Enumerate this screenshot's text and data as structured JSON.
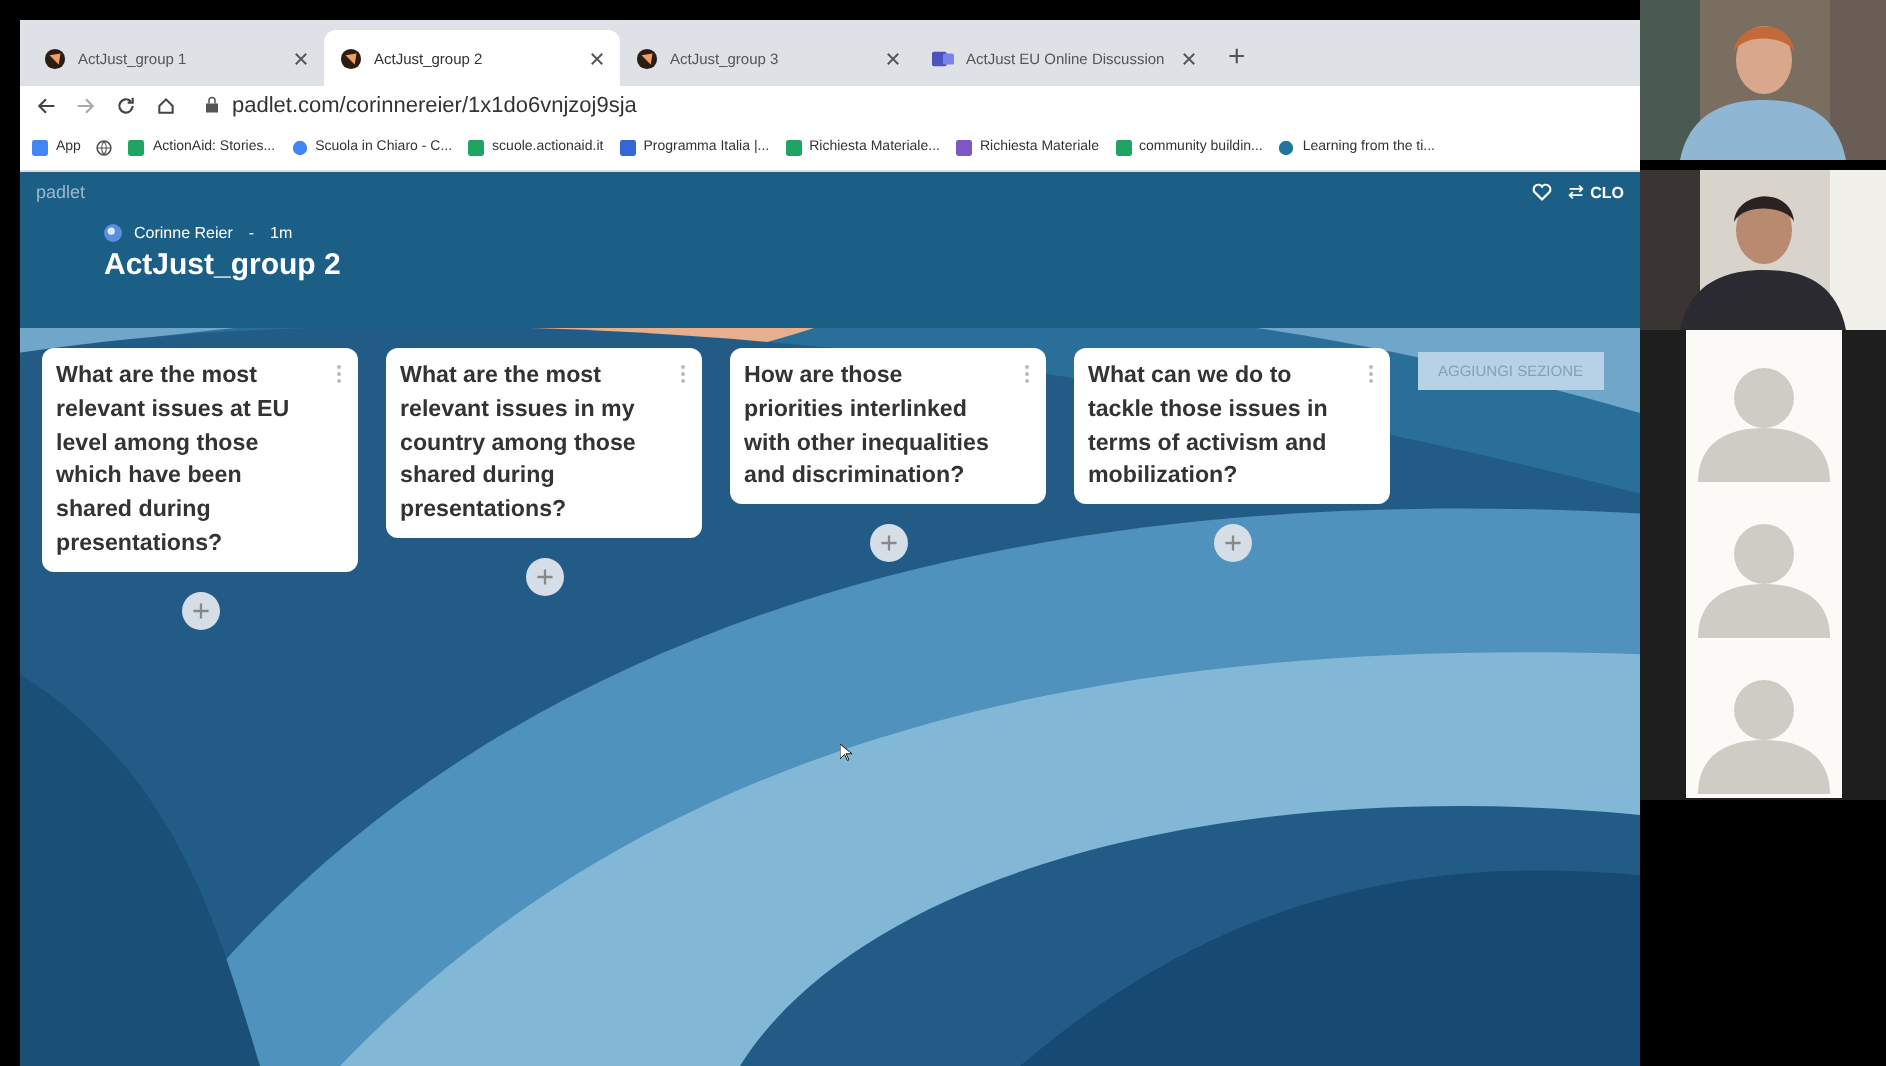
{
  "browser": {
    "tabs": [
      {
        "title": "ActJust_group 1",
        "selected": false,
        "kind": "padlet"
      },
      {
        "title": "ActJust_group 2",
        "selected": true,
        "kind": "padlet"
      },
      {
        "title": "ActJust_group 3",
        "selected": false,
        "kind": "padlet"
      },
      {
        "title": "ActJust EU Online Discussion",
        "selected": false,
        "kind": "teams"
      }
    ],
    "new_tab": "+",
    "url": "padlet.com/corinnereier/1x1do6vnjzoj9sja",
    "bookmarks": [
      {
        "label": "App",
        "kind": "apps"
      },
      {
        "kind": "globe"
      },
      {
        "label": "ActionAid: Stories...",
        "kind": "green"
      },
      {
        "label": "Scuola in Chiaro - C...",
        "kind": "person"
      },
      {
        "label": "scuole.actionaid.it",
        "kind": "green"
      },
      {
        "label": "Programma Italia |...",
        "kind": "blue"
      },
      {
        "label": "Richiesta Materiale...",
        "kind": "green"
      },
      {
        "label": "Richiesta Materiale",
        "kind": "purple"
      },
      {
        "label": "community buildin...",
        "kind": "green"
      },
      {
        "label": "Learning from the ti...",
        "kind": "wordpress"
      }
    ]
  },
  "padlet": {
    "logo": "padlet",
    "remake": "CLO",
    "author": "Corinne Reier",
    "separator": "-",
    "time": "1m",
    "title": "ActJust_group 2",
    "sections": [
      {
        "title": "What are the most relevant issues at EU level among those which have been shared during presentations?"
      },
      {
        "title": "What are the most relevant issues in my country among those shared during presentations?"
      },
      {
        "title": "How are those priorities interlinked with other inequalities and discrimination?"
      },
      {
        "title": "What can we do to tackle those issues in terms of activism and mobilization?"
      }
    ],
    "add_section": "AGGIUNGI SEZIONE"
  },
  "call": {
    "participants": [
      {
        "kind": "video"
      },
      {
        "kind": "video"
      },
      {
        "kind": "avatar"
      },
      {
        "kind": "avatar"
      },
      {
        "kind": "avatar"
      }
    ]
  }
}
